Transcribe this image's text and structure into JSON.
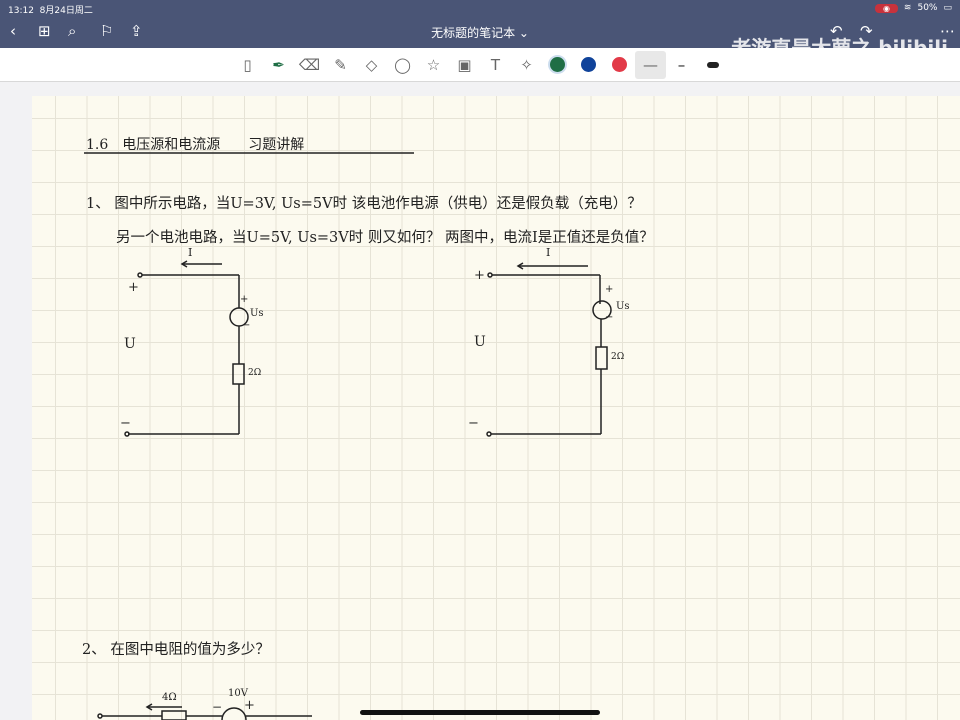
{
  "status": {
    "time": "13:12",
    "date": "8月24日周二",
    "battery": "50%"
  },
  "nav": {
    "title": "无标题的笔记本 ⌄",
    "watermark": "老游直是大萝之 bilibili"
  },
  "colors": {
    "green": "#1f6e45",
    "blue": "#10439a",
    "red": "#e23a48"
  },
  "note": {
    "heading": "1.6　电压源和电流源　　习题讲解",
    "q1_line1": "1、 图中所示电路，当U=3V, Us=5V时 该电池作电源（供电）还是假负载（充电）？",
    "q1_line2": "另一个电池电路，当U=5V, Us=3V时 则又如何？ 两图中，电流I是正值还是负值？",
    "c1": {
      "current": "I",
      "plus": "+",
      "minus": "−",
      "u": "U",
      "us": "Us",
      "us_plus": "+",
      "us_minus": "−",
      "r": "2Ω"
    },
    "c2": {
      "current": "I",
      "plus": "+",
      "minus": "−",
      "u": "U",
      "us": "Us",
      "us_plus": "+",
      "us_minus": "−",
      "r": "2Ω"
    },
    "q2": "2、 在图中电阻的值为多少？",
    "c3": {
      "r": "4Ω",
      "v": "10V",
      "minus": "−",
      "plus": "+"
    }
  }
}
